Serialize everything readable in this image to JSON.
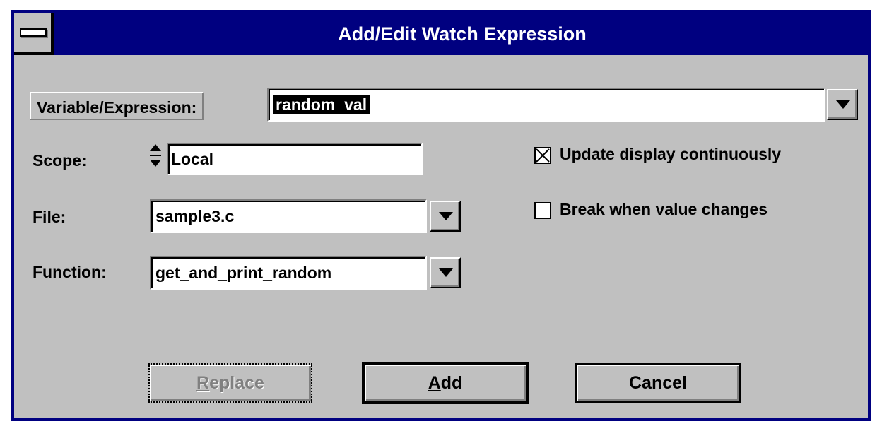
{
  "window": {
    "title": "Add/Edit Watch Expression"
  },
  "expression": {
    "label": "Variable/Expression:",
    "value": "random_val"
  },
  "scope": {
    "label": "Scope:",
    "value": "Local"
  },
  "file": {
    "label": "File:",
    "value": "sample3.c"
  },
  "function": {
    "label": "Function:",
    "value": "get_and_print_random"
  },
  "options": {
    "update_label": "Update display continuously",
    "update_checked": true,
    "break_label": "Break when value changes",
    "break_checked": false
  },
  "buttons": {
    "replace_first": "R",
    "replace_rest": "eplace",
    "replace_enabled": false,
    "add_first": "A",
    "add_rest": "dd",
    "cancel_label": "Cancel"
  },
  "icons": {
    "system_menu": "minus-bar-icon",
    "dropdown": "triangle-down-icon",
    "spinner": "up-down-arrows-icon",
    "checkbox_checked": "x-checkbox-icon"
  },
  "colors": {
    "title_bar": "#000080",
    "dialog_bg": "#c0c0c0",
    "selection_bg": "#000000"
  }
}
